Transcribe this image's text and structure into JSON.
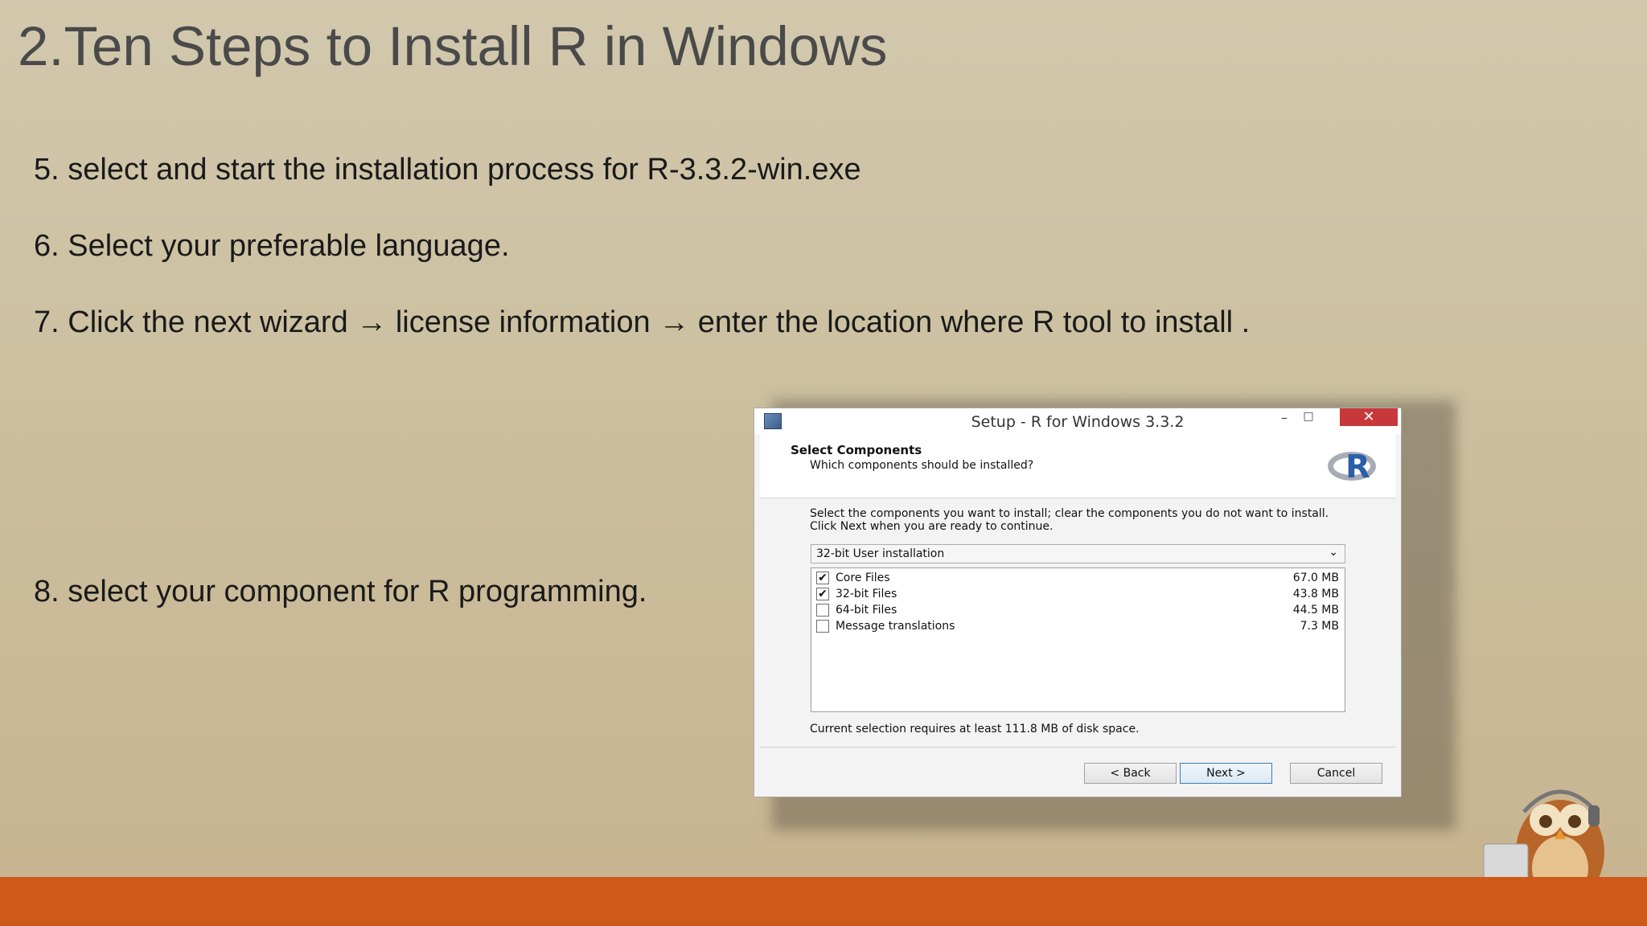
{
  "slide": {
    "title": "2.Ten Steps to Install R in Windows",
    "bullets": {
      "b5": "5. select and start the installation process for R-3.3.2-win.exe",
      "b6": "6. Select your preferable language.",
      "b7": "7. Click the next wizard → license information → enter the location where R tool to install .",
      "b8": "8. select your component for R programming."
    }
  },
  "dialog": {
    "title": "Setup - R for Windows 3.3.2",
    "window_buttons": {
      "minimize": "–",
      "maximize": "□",
      "close": "✕"
    },
    "header_title": "Select Components",
    "header_subtitle": "Which components should be installed?",
    "description": "Select the components you want to install; clear the components you do not want to install. Click Next when you are ready to continue.",
    "install_type": "32-bit User installation",
    "dropdown_arrow": "⌄",
    "components": [
      {
        "name": "Core Files",
        "size": "67.0 MB",
        "checked": true
      },
      {
        "name": "32-bit Files",
        "size": "43.8 MB",
        "checked": true
      },
      {
        "name": "64-bit Files",
        "size": "44.5 MB",
        "checked": false
      },
      {
        "name": "Message translations",
        "size": "7.3 MB",
        "checked": false
      }
    ],
    "disk_note": "Current selection requires at least 111.8 MB of disk space.",
    "buttons": {
      "back": "< Back",
      "next": "Next >",
      "cancel": "Cancel"
    },
    "logo_letter": "R"
  },
  "colors": {
    "bottom_bar": "#cd5a18",
    "close_button": "#c8383a",
    "r_logo_blue": "#2a5fa8"
  },
  "icons": {
    "app_icon": "setup-app-icon",
    "mascot": "owl-mascot-icon",
    "check": "✔"
  }
}
